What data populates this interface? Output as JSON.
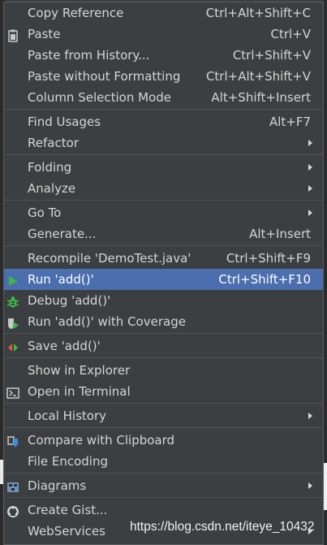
{
  "menu": {
    "copy_reference": {
      "label": "Copy Reference",
      "shortcut": "Ctrl+Alt+Shift+C"
    },
    "paste": {
      "label": "Paste",
      "shortcut": "Ctrl+V",
      "icon": "clipboard-icon"
    },
    "paste_history": {
      "label": "Paste from History...",
      "shortcut": "Ctrl+Shift+V"
    },
    "paste_plain": {
      "label": "Paste without Formatting",
      "shortcut": "Ctrl+Alt+Shift+V"
    },
    "column_selection": {
      "label": "Column Selection Mode",
      "shortcut": "Alt+Shift+Insert"
    },
    "find_usages": {
      "label": "Find Usages",
      "shortcut": "Alt+F7"
    },
    "refactor": {
      "label": "Refactor"
    },
    "folding": {
      "label": "Folding"
    },
    "analyze": {
      "label": "Analyze"
    },
    "go_to": {
      "label": "Go To"
    },
    "generate": {
      "label": "Generate...",
      "shortcut": "Alt+Insert"
    },
    "recompile": {
      "label": "Recompile 'DemoTest.java'",
      "shortcut": "Ctrl+Shift+F9"
    },
    "run": {
      "label": "Run 'add()'",
      "shortcut": "Ctrl+Shift+F10",
      "icon": "run-icon"
    },
    "debug": {
      "label": "Debug 'add()'",
      "icon": "bug-icon"
    },
    "run_coverage": {
      "label": "Run 'add()' with Coverage",
      "icon": "coverage-icon"
    },
    "save": {
      "label": "Save 'add()'",
      "icon": "save-config-icon"
    },
    "show_explorer": {
      "label": "Show in Explorer"
    },
    "open_terminal": {
      "label": "Open in Terminal",
      "icon": "terminal-icon"
    },
    "local_history": {
      "label": "Local History"
    },
    "compare_clipboard": {
      "label": "Compare with Clipboard",
      "icon": "compare-icon"
    },
    "file_encoding": {
      "label": "File Encoding"
    },
    "diagrams": {
      "label": "Diagrams",
      "icon": "diagram-icon"
    },
    "create_gist": {
      "label": "Create Gist...",
      "icon": "github-icon"
    },
    "webservices": {
      "label": "WebServices"
    }
  },
  "colors": {
    "background": "#3c3f41",
    "selection": "#4b6eaf",
    "run_green": "#3fb34f",
    "text": "#d4d4d4"
  },
  "watermark": "https://blog.csdn.net/iteye_10432"
}
